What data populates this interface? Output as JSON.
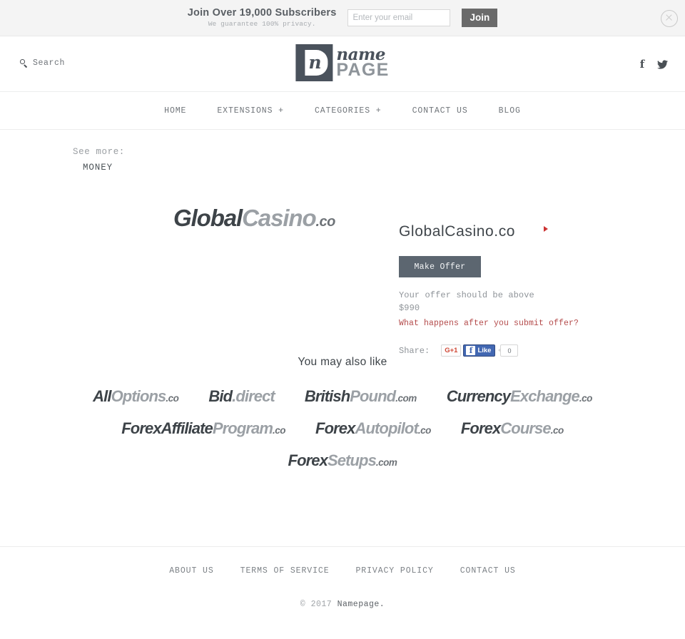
{
  "subscribe_bar": {
    "title": "Join Over 19,000 Subscribers",
    "subtitle": "We guarantee 100% privacy.",
    "input_placeholder": "Enter your email",
    "input_value": "",
    "join_label": "Join",
    "close_icon": "close-circle-icon"
  },
  "header": {
    "search_label": "Search",
    "search_icon": "search-icon",
    "logo": {
      "mark_letter": "n",
      "name": "name",
      "page": "PAGE"
    },
    "social": [
      {
        "name": "facebook",
        "glyph": "f"
      },
      {
        "name": "twitter",
        "glyph": "twitter-bird-icon"
      }
    ]
  },
  "nav": {
    "items": [
      {
        "label": "HOME"
      },
      {
        "label": "EXTENSIONS +"
      },
      {
        "label": "CATEGORIES +"
      },
      {
        "label": "CONTACT US"
      },
      {
        "label": "BLOG"
      }
    ]
  },
  "see_more": {
    "label": "See more:",
    "category": "MONEY"
  },
  "hero": {
    "wordmark": {
      "part_a": "Global",
      "part_b": "Casino",
      "tld": ".co"
    },
    "domain_title": "GlobalCasino.co",
    "make_offer_label": "Make Offer",
    "offer_note": "Your offer should be above $990",
    "offer_minimum": "$990",
    "offer_link": "What happens after you submit offer?",
    "accent_red": "#b44b4b",
    "button_color": "#5c6670",
    "share": {
      "label": "Share:",
      "gplus_label": "G+1",
      "fb_like_label": "Like",
      "fb_like_glyph": "f",
      "fb_count": "0"
    }
  },
  "related": {
    "title": "You may also like",
    "rows": [
      [
        {
          "part_a": "All",
          "part_b": "Options",
          "tld": ".co"
        },
        {
          "part_a": "Bid",
          "part_b": ".direct",
          "tld": ""
        },
        {
          "part_a": "British",
          "part_b": "Pound",
          "tld": ".com"
        },
        {
          "part_a": "Currency",
          "part_b": "Exchange",
          "tld": ".co"
        }
      ],
      [
        {
          "part_a": "ForexAffiliate",
          "part_b": "Program",
          "tld": ".co"
        },
        {
          "part_a": "Forex",
          "part_b": "Autopilot",
          "tld": ".co"
        },
        {
          "part_a": "Forex",
          "part_b": "Course",
          "tld": ".co"
        }
      ],
      [
        {
          "part_a": "Forex",
          "part_b": "Setups",
          "tld": ".com"
        }
      ]
    ]
  },
  "footer": {
    "links": [
      {
        "label": "ABOUT US"
      },
      {
        "label": "TERMS OF SERVICE"
      },
      {
        "label": "PRIVACY POLICY"
      },
      {
        "label": "CONTACT US"
      }
    ],
    "copyright_prefix": "© 2017 ",
    "copyright_brand": "Namepage."
  }
}
